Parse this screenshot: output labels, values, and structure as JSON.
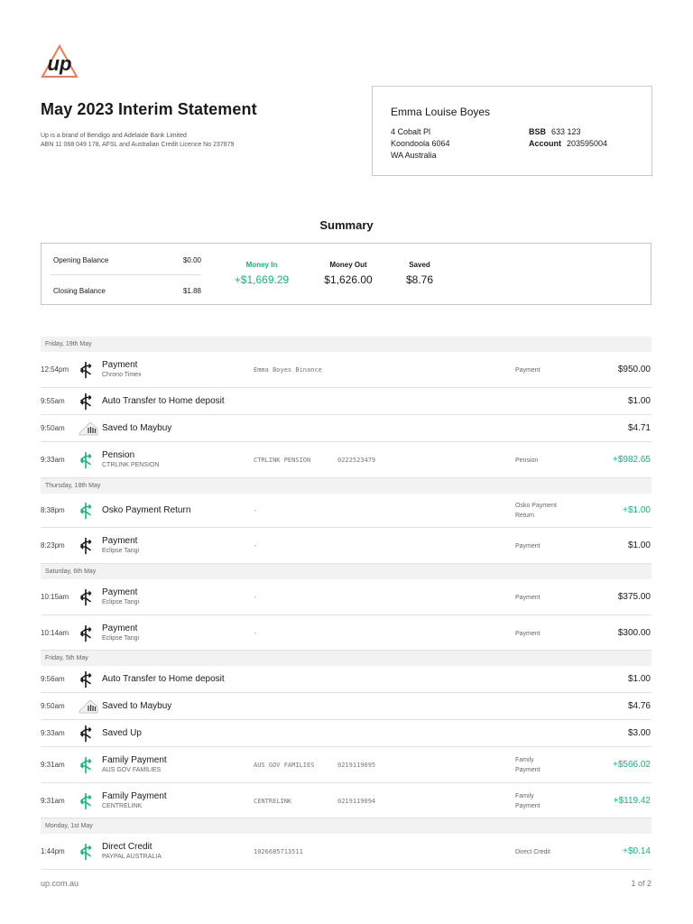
{
  "colors": {
    "positive": "#16b37e",
    "logo_orange": "#f07a55",
    "text": "#1a1a1a"
  },
  "logo": {
    "icon": "up-logo-icon",
    "text": "up"
  },
  "statement": {
    "title": "May 2023 Interim Statement",
    "brand_line1": "Up is a brand of Bendigo and Adelaide Bank Limited",
    "brand_line2": "ABN 11 068 049 178, AFSL and Australian Credit Licence No 237879"
  },
  "account": {
    "name": "Emma Louise Boyes",
    "address": [
      "4 Cobalt Pl",
      "Koondoola 6064",
      "WA Australia"
    ],
    "bsb_label": "BSB",
    "bsb": "633 123",
    "account_label": "Account",
    "account_number": "203595004"
  },
  "summary": {
    "title": "Summary",
    "opening_label": "Opening Balance",
    "opening_value": "$0.00",
    "closing_label": "Closing Balance",
    "closing_value": "$1.88",
    "money_in_label": "Money In",
    "money_in": "+$1,669.29",
    "money_out_label": "Money Out",
    "money_out": "$1,626.00",
    "saved_label": "Saved",
    "saved": "$8.76"
  },
  "days": [
    {
      "label": "Friday, 19th May",
      "transactions": [
        {
          "time": "12:54pm",
          "icon": "transfer",
          "title": "Payment",
          "subtitle": "Chrono Timex",
          "desc": "Emma Boyes Binance",
          "ref": "",
          "category": [
            "Payment"
          ],
          "amount": "$950.00",
          "positive": false,
          "h": 40
        },
        {
          "time": "9:55am",
          "icon": "transfer",
          "title": "Auto Transfer to Home deposit",
          "subtitle": "",
          "desc": "",
          "ref": "",
          "category": [],
          "amount": "$1.00",
          "positive": false,
          "h": 30
        },
        {
          "time": "9:50am",
          "icon": "saver",
          "title": "Saved to Maybuy",
          "subtitle": "",
          "desc": "",
          "ref": "",
          "category": [],
          "amount": "$4.71",
          "positive": false,
          "h": 30
        },
        {
          "time": "9:33am",
          "icon": "transfer-green",
          "title": "Pension",
          "subtitle": "CTRLINK PENSION",
          "desc": "CTRLINK PENSION",
          "ref": "0222523479",
          "category": [
            "Pension"
          ],
          "amount": "+$982.65",
          "positive": true,
          "h": 40
        }
      ]
    },
    {
      "label": "Thursday, 18th May",
      "transactions": [
        {
          "time": "8:38pm",
          "icon": "transfer-green",
          "title": "Osko Payment Return",
          "subtitle": "",
          "desc": "-",
          "ref": "",
          "category": [
            "Osko Payment",
            "Return"
          ],
          "amount": "+$1.00",
          "positive": true,
          "h": 38
        },
        {
          "time": "8:23pm",
          "icon": "transfer",
          "title": "Payment",
          "subtitle": "Eclipse Tangi",
          "desc": "-",
          "ref": "",
          "category": [
            "Payment"
          ],
          "amount": "$1.00",
          "positive": false,
          "h": 40
        }
      ]
    },
    {
      "label": "Saturday, 6th May",
      "transactions": [
        {
          "time": "10:15am",
          "icon": "transfer",
          "title": "Payment",
          "subtitle": "Eclipse Tangi",
          "desc": "-",
          "ref": "",
          "category": [
            "Payment"
          ],
          "amount": "$375.00",
          "positive": false,
          "h": 40
        },
        {
          "time": "10:14am",
          "icon": "transfer",
          "title": "Payment",
          "subtitle": "Eclipse Tangi",
          "desc": "-",
          "ref": "",
          "category": [
            "Payment"
          ],
          "amount": "$300.00",
          "positive": false,
          "h": 39
        }
      ]
    },
    {
      "label": "Friday, 5th May",
      "transactions": [
        {
          "time": "9:56am",
          "icon": "transfer",
          "title": "Auto Transfer to Home deposit",
          "subtitle": "",
          "desc": "",
          "ref": "",
          "category": [],
          "amount": "$1.00",
          "positive": false,
          "h": 30
        },
        {
          "time": "9:50am",
          "icon": "saver",
          "title": "Saved to Maybuy",
          "subtitle": "",
          "desc": "",
          "ref": "",
          "category": [],
          "amount": "$4.76",
          "positive": false,
          "h": 30
        },
        {
          "time": "9:33am",
          "icon": "transfer",
          "title": "Saved Up",
          "subtitle": "",
          "desc": "",
          "ref": "",
          "category": [],
          "amount": "$3.00",
          "positive": false,
          "h": 30
        },
        {
          "time": "9:31am",
          "icon": "transfer-green",
          "title": "Family Payment",
          "subtitle": "AUS GOV FAMILIES",
          "desc": "AUS GOV FAMILIES",
          "ref": "0219119095",
          "category": [
            "Family",
            "Payment"
          ],
          "amount": "+$566.02",
          "positive": true,
          "h": 40
        },
        {
          "time": "9:31am",
          "icon": "transfer-green",
          "title": "Family Payment",
          "subtitle": "CENTRELINK",
          "desc": "CENTRELINK",
          "ref": "0219119094",
          "category": [
            "Family",
            "Payment"
          ],
          "amount": "+$119.42",
          "positive": true,
          "h": 39
        }
      ]
    },
    {
      "label": "Monday, 1st May",
      "transactions": [
        {
          "time": "1:44pm",
          "icon": "transfer-green",
          "title": "Direct Credit",
          "subtitle": "PAYPAL AUSTRALIA",
          "desc": "1026685713511",
          "ref": "",
          "category": [
            "Direct Credit"
          ],
          "amount": "+$0.14",
          "positive": true,
          "h": 40
        }
      ]
    }
  ],
  "footer": {
    "website": "up.com.au",
    "page": "1 of 2"
  }
}
